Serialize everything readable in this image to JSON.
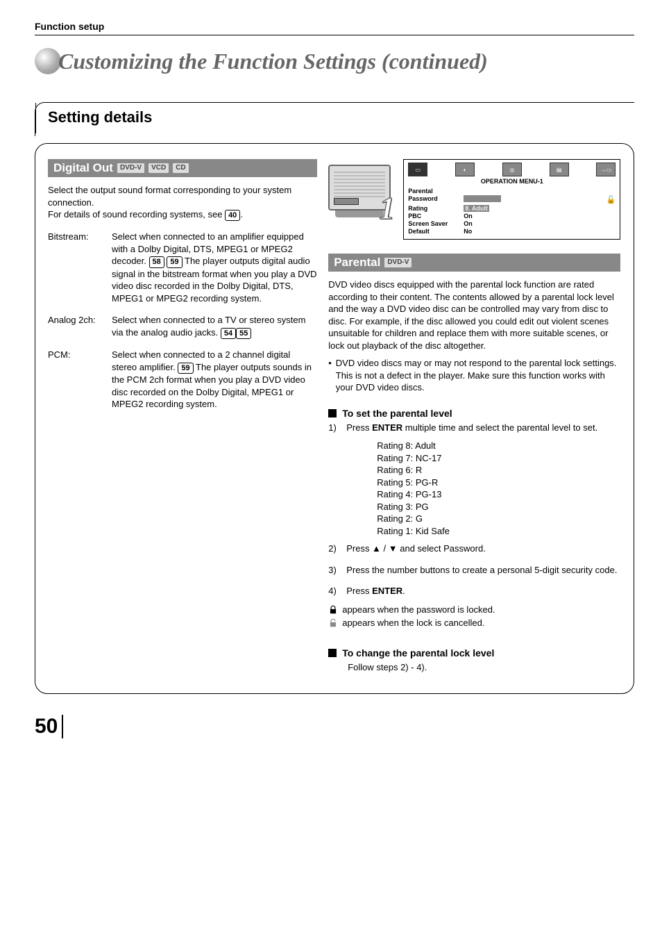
{
  "header": "Function setup",
  "title": "Customizing the Function Settings (continued)",
  "section_title": "Setting details",
  "digital_out": {
    "heading": "Digital Out",
    "badges": [
      "DVD-V",
      "VCD",
      "CD"
    ],
    "intro1": "Select the output sound format corresponding to your system connection.",
    "intro2_a": "For details of sound recording systems, see ",
    "intro2_ref": "40",
    "intro2_b": ".",
    "rows": [
      {
        "term": "Bitstream:",
        "desc_a": "Select when connected to an amplifier equipped with a Dolby Digital, DTS, MPEG1 or MPEG2 decoder. ",
        "refs": [
          "58",
          "59"
        ],
        "desc_b": " The player outputs digital audio signal in the bitstream format when you play a DVD video disc recorded in the Dolby Digital, DTS, MPEG1 or MPEG2 recording system."
      },
      {
        "term": "Analog 2ch:",
        "desc_a": "Select when connected to a TV or stereo system via the analog audio jacks. ",
        "refs": [
          "54",
          "55"
        ],
        "desc_b": ""
      },
      {
        "term": "PCM:",
        "desc_a": "Select when connected to a 2 channel digital stereo amplifier. ",
        "refs": [
          "59"
        ],
        "desc_b": " The player outputs sounds in the PCM 2ch format when you play a DVD video disc recorded on the Dolby Digital, MPEG1 or MPEG2 recording system."
      }
    ]
  },
  "osd": {
    "step_num": "1",
    "title": "OPERATION MENU-1",
    "rows": [
      {
        "label": "Parental",
        "value": ""
      },
      {
        "label": " Password",
        "value": ""
      },
      {
        "label": " Rating",
        "value": "8. Adult",
        "hl": true
      },
      {
        "label": "PBC",
        "value": "On"
      },
      {
        "label": "Screen Saver",
        "value": "On"
      },
      {
        "label": "Default",
        "value": "No"
      }
    ]
  },
  "parental": {
    "heading": "Parental",
    "badge": "DVD-V",
    "para": "DVD video discs equipped with the parental lock function are rated according to their content. The contents allowed by a parental lock level and the way a DVD video disc can be controlled may vary from disc to disc. For example, if the disc allowed you could edit out violent scenes unsuitable for children and replace them with more suitable scenes, or lock out playback of the disc altogether.",
    "note": "DVD video discs may or may not respond to the parental lock settings. This is not a defect in the player. Make sure this function works with your DVD video discs.",
    "set_heading": "To set the parental level",
    "step1_a": "Press ",
    "step1_b": "ENTER",
    "step1_c": " multiple time and select the parental level to set.",
    "ratings": [
      "Rating 8: Adult",
      "Rating 7: NC-17",
      "Rating 6: R",
      "Rating 5: PG-R",
      "Rating 4: PG-13",
      "Rating 3: PG",
      "Rating 2: G",
      "Rating 1: Kid Safe"
    ],
    "step2": "Press ▲ / ▼ and select Password.",
    "step3": "Press the number buttons to create a personal 5-digit security code.",
    "step4_a": "Press ",
    "step4_b": "ENTER",
    "step4_c": ".",
    "locked_text": "appears when the password is locked.",
    "unlocked_text": "appears when the lock is cancelled.",
    "change_heading": "To change the parental lock level",
    "change_text": "Follow steps 2) - 4)."
  },
  "page_number": "50"
}
